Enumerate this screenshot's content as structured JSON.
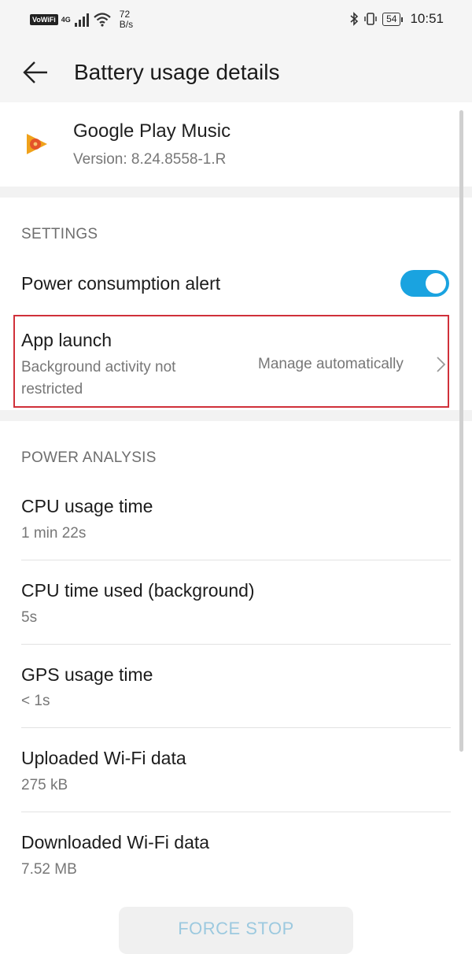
{
  "status_bar": {
    "vowifi": "VoWiFi",
    "network": "4G",
    "speed_value": "72",
    "speed_unit": "B/s",
    "battery": "54",
    "time": "10:51"
  },
  "toolbar": {
    "title": "Battery usage details"
  },
  "app": {
    "name": "Google Play Music",
    "version": "Version: 8.24.8558-1.R"
  },
  "settings": {
    "header": "SETTINGS",
    "power_alert": {
      "label": "Power consumption alert",
      "enabled": true
    },
    "app_launch": {
      "label": "App launch",
      "sub_line1": "Background activity not",
      "sub_line2": "restricted",
      "value": "Manage automatically"
    }
  },
  "power_analysis": {
    "header": "POWER ANALYSIS",
    "items": [
      {
        "label": "CPU usage time",
        "value": "1 min 22s"
      },
      {
        "label": "CPU time used (background)",
        "value": "5s"
      },
      {
        "label": "GPS usage time",
        "value": "< 1s"
      },
      {
        "label": "Uploaded Wi-Fi data",
        "value": "275 kB"
      },
      {
        "label": "Downloaded Wi-Fi data",
        "value": "7.52 MB"
      }
    ]
  },
  "footer": {
    "force_stop": "FORCE STOP"
  },
  "colors": {
    "accent": "#1aa3e0",
    "highlight_border": "#d0303a"
  }
}
